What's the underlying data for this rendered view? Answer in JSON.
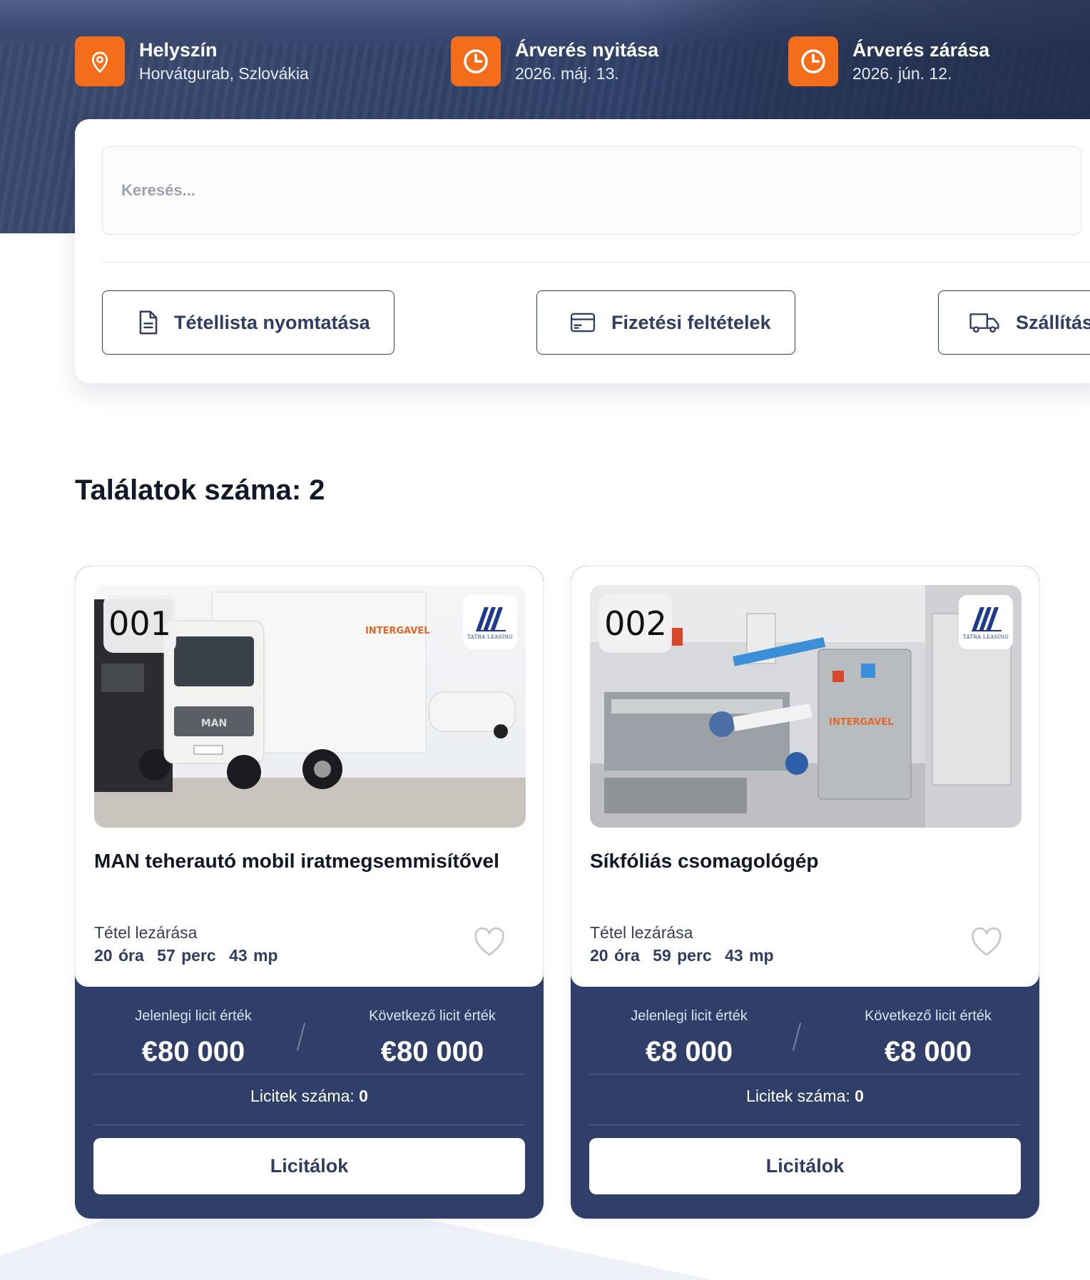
{
  "colors": {
    "accent": "#f46d1b",
    "navy": "#2f3f69",
    "hero": "#34456b"
  },
  "hero": {
    "location": {
      "label": "Helyszín",
      "value": "Horvátgurab, Szlovákia",
      "icon": "map-pin-icon"
    },
    "opening": {
      "label": "Árverés nyitása",
      "value": "2026. máj. 13.",
      "icon": "clock-icon"
    },
    "closing": {
      "label": "Árverés zárása",
      "value": "2026. jún. 12.",
      "icon": "clock-icon"
    }
  },
  "search": {
    "placeholder": "Keresés..."
  },
  "actions": {
    "print": {
      "label": "Tétellista nyomtatása",
      "icon": "document-icon"
    },
    "payment": {
      "label": "Fizetési feltételek",
      "icon": "credit-card-icon"
    },
    "shipping": {
      "label": "Szállítás",
      "icon": "truck-icon"
    }
  },
  "results": {
    "title": "Találatok száma: 2"
  },
  "lots": [
    {
      "number": "001",
      "brand": "TATRA LEASING",
      "title": "MAN teherautó mobil iratmegsemmisítővel",
      "close_label": "Tétel lezárása",
      "timer": {
        "hours": "20 óra",
        "minutes": "57 perc",
        "seconds": "43 mp"
      },
      "current_label": "Jelenlegi licit érték",
      "current_value": "€80 000",
      "next_label": "Következő licit érték",
      "next_value": "€80 000",
      "count_label": "Licitek száma:",
      "count_value": "0",
      "bid_button": "Licitálok"
    },
    {
      "number": "002",
      "brand": "TATRA LEASING",
      "title": "Síkfóliás csomagológép",
      "close_label": "Tétel lezárása",
      "timer": {
        "hours": "20 óra",
        "minutes": "59 perc",
        "seconds": "43 mp"
      },
      "current_label": "Jelenlegi licit érték",
      "current_value": "€8 000",
      "next_label": "Következő licit érték",
      "next_value": "€8 000",
      "count_label": "Licitek száma:",
      "count_value": "0",
      "bid_button": "Licitálok"
    }
  ]
}
